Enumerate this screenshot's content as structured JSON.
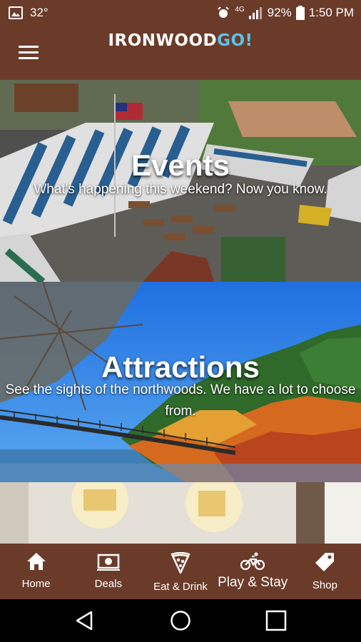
{
  "status_bar": {
    "temperature": "32°",
    "network": "4G",
    "battery": "92%",
    "time": "1:50 PM"
  },
  "app_bar": {
    "logo_main": "IRONWOOD",
    "logo_accent": "GO!"
  },
  "cards": [
    {
      "title": "Events",
      "subtitle": "What's happening this weekend? Now you know."
    },
    {
      "title": "Attractions",
      "subtitle": "See the sights of the northwoods. We have a lot to choose from."
    }
  ],
  "bottom_nav": {
    "items": [
      {
        "label": "Home",
        "icon": "home-icon"
      },
      {
        "label": "Deals",
        "icon": "deals-icon"
      },
      {
        "label": "Eat & Drink",
        "icon": "pizza-icon"
      },
      {
        "label": "Play & Stay",
        "icon": "bicycle-icon"
      },
      {
        "label": "Shop",
        "icon": "tag-icon"
      }
    ],
    "active": "Play & Stay"
  },
  "colors": {
    "brand_brown": "#6b3b2a",
    "accent_blue": "#5ec1e8"
  }
}
